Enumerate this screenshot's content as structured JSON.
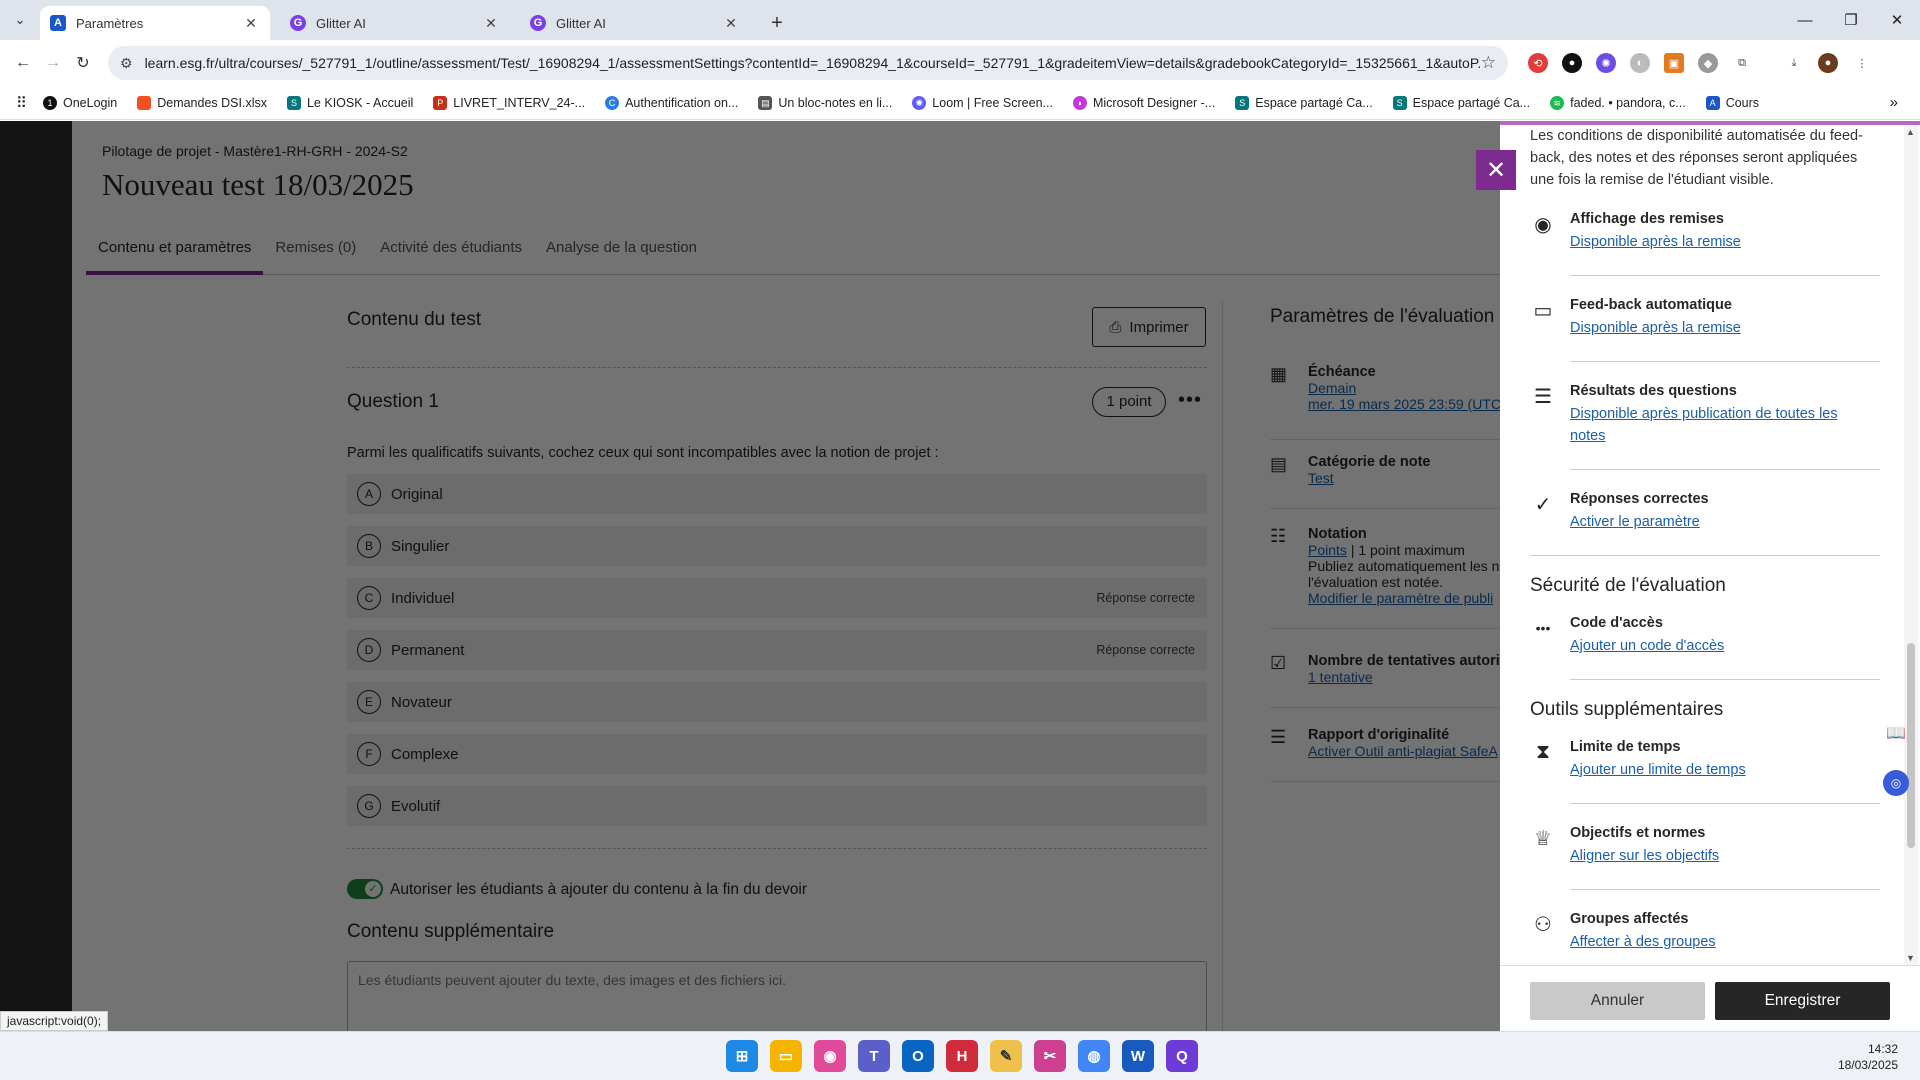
{
  "browser": {
    "tabs": [
      {
        "title": "Paramètres",
        "icon": "blackboard-icon"
      },
      {
        "title": "Glitter AI",
        "icon": "glitter-icon"
      },
      {
        "title": "Glitter AI",
        "icon": "glitter-icon"
      }
    ],
    "url": "learn.esg.fr/ultra/courses/_527791_1/outline/assessment/Test/_16908294_1/assessmentSettings?contentId=_16908294_1&courseId=_527791_1&gradeitemView=details&gradebookCategoryId=_15325661_1&autoP...",
    "bookmarks": [
      "OneLogin",
      "Demandes DSI.xlsx",
      "Le KIOSK - Accueil",
      "LIVRET_INTERV_24-...",
      "Authentification on...",
      "Un bloc-notes en li...",
      "Loom | Free Screen...",
      "Microsoft Designer -...",
      "Espace partagé Ca...",
      "Espace partagé Ca...",
      "faded. • pandora, c...",
      "Cours"
    ]
  },
  "course": {
    "name": "Pilotage de projet - Mastère1-RH-GRH - 2024-S2",
    "title": "Nouveau test 18/03/2025",
    "tabs": [
      "Contenu et paramètres",
      "Remises (0)",
      "Activité des étudiants",
      "Analyse de la question"
    ]
  },
  "test": {
    "section_title": "Contenu du test",
    "print_label": "Imprimer",
    "question_title": "Question 1",
    "points": "1 point",
    "question_text": "Parmi les qualificatifs suivants, cochez ceux qui sont incompatibles avec la notion de projet :",
    "answers": [
      {
        "letter": "A",
        "text": "Original",
        "correct": ""
      },
      {
        "letter": "B",
        "text": "Singulier",
        "correct": ""
      },
      {
        "letter": "C",
        "text": "Individuel",
        "correct": "Réponse correcte"
      },
      {
        "letter": "D",
        "text": "Permanent",
        "correct": "Réponse correcte"
      },
      {
        "letter": "E",
        "text": "Novateur",
        "correct": ""
      },
      {
        "letter": "F",
        "text": "Complexe",
        "correct": ""
      },
      {
        "letter": "G",
        "text": "Evolutif",
        "correct": ""
      }
    ],
    "toggle_label": "Autoriser les étudiants à ajouter du contenu à la fin du devoir",
    "supp_title": "Contenu supplémentaire",
    "supp_placeholder": "Les étudiants peuvent ajouter du texte, des images et des fichiers ici."
  },
  "settings_col": {
    "title": "Paramètres de l'évaluation",
    "echeance_title": "Échéance",
    "echeance_link1": "Demain",
    "echeance_link2": "mer. 19 mars 2025 23:59 (UTC",
    "cat_title": "Catégorie de note",
    "cat_link": "Test",
    "notation_title": "Notation",
    "notation_link": "Points",
    "notation_text": "| 1 point maximum",
    "notation_line2": "Publiez automatiquement les n",
    "notation_line3": "l'évaluation est notée.",
    "notation_link2": "Modifier le paramètre de publi",
    "tent_title": "Nombre de tentatives autori",
    "tent_link": "1 tentative",
    "orig_title": "Rapport d'originalité",
    "orig_link": "Activer Outil anti-plagiat SafeA"
  },
  "panel": {
    "intro": "Les conditions de disponibilité automatisée du feed-back, des notes et des réponses seront appliquées une fois la remise de l'étudiant visible.",
    "items": [
      {
        "title": "Affichage des remises",
        "link": "Disponible après la remise"
      },
      {
        "title": "Feed-back automatique",
        "link": "Disponible après la remise"
      },
      {
        "title": "Résultats des questions",
        "link": "Disponible après publication de toutes les notes"
      },
      {
        "title": "Réponses correctes",
        "link": "Activer le paramètre"
      }
    ],
    "security_title": "Sécurité de l'évaluation",
    "access_title": "Code d'accès",
    "access_link": "Ajouter un code d'accès",
    "tools_title": "Outils supplémentaires",
    "tools": [
      {
        "title": "Limite de temps",
        "link": "Ajouter une limite de temps"
      },
      {
        "title": "Objectifs et normes",
        "link": "Aligner sur les objectifs"
      },
      {
        "title": "Groupes affectés",
        "link": "Affecter à des groupes"
      }
    ],
    "cancel": "Annuler",
    "save": "Enregistrer"
  },
  "status_url": "javascript:void(0);",
  "clock": {
    "time": "14:32",
    "date": "18/03/2025"
  }
}
